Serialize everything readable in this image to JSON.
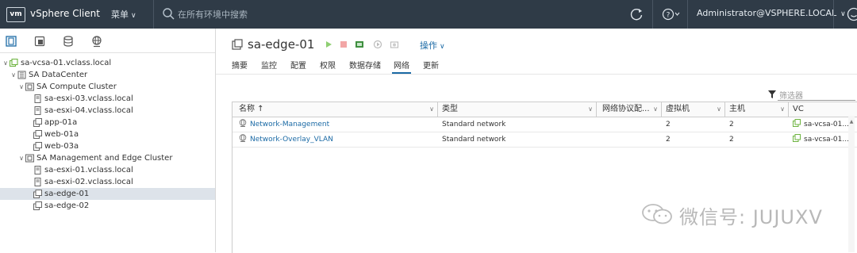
{
  "header": {
    "logo": "vm",
    "app_name": "vSphere Client",
    "menu_label": "菜单",
    "search_placeholder": "在所有环境中搜索",
    "user_label": "Administrator@VSPHERE.LOCAL"
  },
  "navigator": {
    "tabs": [
      "hosts-and-clusters",
      "vms-and-templates",
      "storage",
      "networking"
    ],
    "tree": [
      {
        "label": "sa-vcsa-01.vclass.local",
        "level": 0,
        "icon": "vcenter-icon",
        "expanded": true
      },
      {
        "label": "SA DataCenter",
        "level": 1,
        "icon": "datacenter-icon",
        "expanded": true
      },
      {
        "label": "SA Compute Cluster",
        "level": 2,
        "icon": "cluster-icon",
        "expanded": true
      },
      {
        "label": "sa-esxi-03.vclass.local",
        "level": 3,
        "icon": "host-icon"
      },
      {
        "label": "sa-esxi-04.vclass.local",
        "level": 3,
        "icon": "host-icon"
      },
      {
        "label": "app-01a",
        "level": 3,
        "icon": "vm-icon"
      },
      {
        "label": "web-01a",
        "level": 3,
        "icon": "vm-icon"
      },
      {
        "label": "web-03a",
        "level": 3,
        "icon": "vm-icon"
      },
      {
        "label": "SA Management and Edge Cluster",
        "level": 2,
        "icon": "cluster-icon",
        "expanded": true
      },
      {
        "label": "sa-esxi-01.vclass.local",
        "level": 3,
        "icon": "host-icon"
      },
      {
        "label": "sa-esxi-02.vclass.local",
        "level": 3,
        "icon": "host-icon"
      },
      {
        "label": "sa-edge-01",
        "level": 3,
        "icon": "vm-icon",
        "selected": true
      },
      {
        "label": "sa-edge-02",
        "level": 3,
        "icon": "vm-icon"
      }
    ]
  },
  "object": {
    "title": "sa-edge-01",
    "actions_label": "操作"
  },
  "tabs": [
    {
      "label": "摘要"
    },
    {
      "label": "监控"
    },
    {
      "label": "配置"
    },
    {
      "label": "权限"
    },
    {
      "label": "数据存储"
    },
    {
      "label": "网络",
      "active": true
    },
    {
      "label": "更新"
    }
  ],
  "filter": {
    "placeholder": "筛选器"
  },
  "table": {
    "columns": [
      "名称 ↑",
      "类型",
      "网络协议配...",
      "虚拟机",
      "主机",
      "VC"
    ],
    "rows": [
      [
        "Network-Management",
        "Standard network",
        "",
        "2",
        "2",
        "sa-vcsa-01..."
      ],
      [
        "Network-Overlay_VLAN",
        "Standard network",
        "",
        "2",
        "2",
        "sa-vcsa-01..."
      ]
    ]
  },
  "watermark": "微信号: JUJUXV",
  "colors": {
    "header_bg": "#2f3b47",
    "accent": "#1b6aa5",
    "selected_row": "#dde3ea",
    "vcenter_green": "#6db33f"
  }
}
